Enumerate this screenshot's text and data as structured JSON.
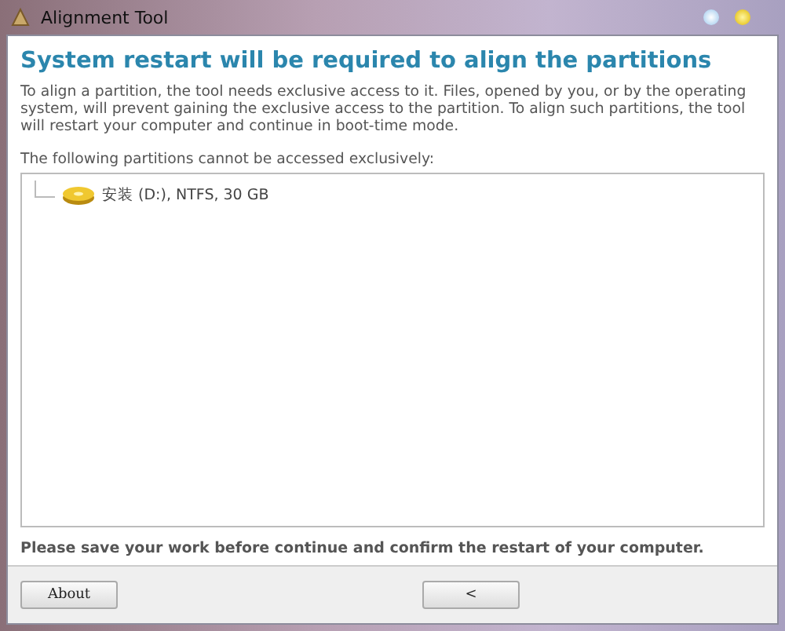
{
  "window": {
    "title": "Alignment Tool"
  },
  "heading": "System restart will be required to align the partitions",
  "description": "To align a partition, the tool needs exclusive access to it. Files, opened by you, or by the operating system, will prevent gaining the exclusive access to the partition. To align such partitions, the tool will restart your computer and continue in boot-time mode.",
  "list_label": "The following partitions cannot be accessed exclusively:",
  "partitions": [
    {
      "label": "安装 (D:), NTFS, 30 GB"
    }
  ],
  "notice": "Please save your work before continue and confirm the restart of your computer.",
  "buttons": [
    {
      "label": "About"
    },
    {
      "label": "<"
    }
  ]
}
